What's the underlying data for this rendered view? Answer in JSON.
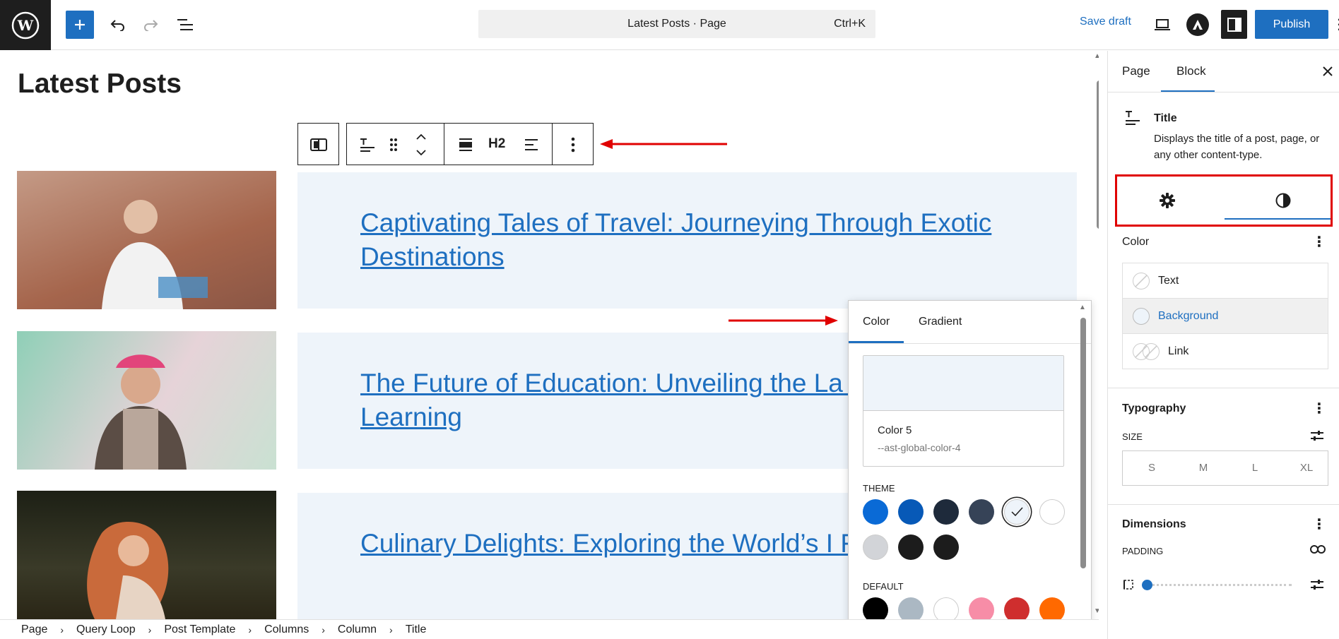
{
  "topbar": {
    "command_title": "Latest Posts · Page",
    "command_shortcut": "Ctrl+K",
    "save_draft": "Save draft",
    "publish": "Publish"
  },
  "editor": {
    "page_title": "Latest Posts",
    "heading_level": "H2",
    "posts": [
      {
        "title": "Captivating Tales of Travel: Journeying Through Exotic Destinations"
      },
      {
        "title": "The Future of Education: Unveiling the La Innovations in Learning"
      },
      {
        "title": "Culinary Delights: Exploring the World’s I Flavors"
      }
    ]
  },
  "breadcrumb": [
    "Page",
    "Query Loop",
    "Post Template",
    "Columns",
    "Column",
    "Title"
  ],
  "sidebar": {
    "tabs": [
      "Page",
      "Block"
    ],
    "active_tab": "Block",
    "block_name": "Title",
    "block_description": "Displays the title of a post, page, or any other content-type.",
    "color_section": "Color",
    "color_items": [
      "Text",
      "Background",
      "Link"
    ],
    "typography_section": "Typography",
    "size_label": "SIZE",
    "sizes": [
      "S",
      "M",
      "L",
      "XL"
    ],
    "dimensions_section": "Dimensions",
    "padding_label": "PADDING"
  },
  "popover": {
    "tabs": [
      "Color",
      "Gradient"
    ],
    "selected_name": "Color 5",
    "selected_var": "--ast-global-color-4",
    "theme_label": "THEME",
    "default_label": "DEFAULT",
    "theme_colors": [
      "#0a6ad6",
      "#0759b7",
      "#1e2a3b",
      "#364357",
      "#eef4fa",
      "#ffffff",
      "#d2d4d8",
      "#1c1c1c",
      "#1c1c1c"
    ],
    "default_colors": [
      "#000000",
      "#abb8c3",
      "#ffffff",
      "#f78da7",
      "#cf2e2e",
      "#ff6900"
    ],
    "selected_color": "#eef4fa"
  },
  "colors": {
    "accent": "#1e6fc0",
    "annotation": "#e00000"
  }
}
